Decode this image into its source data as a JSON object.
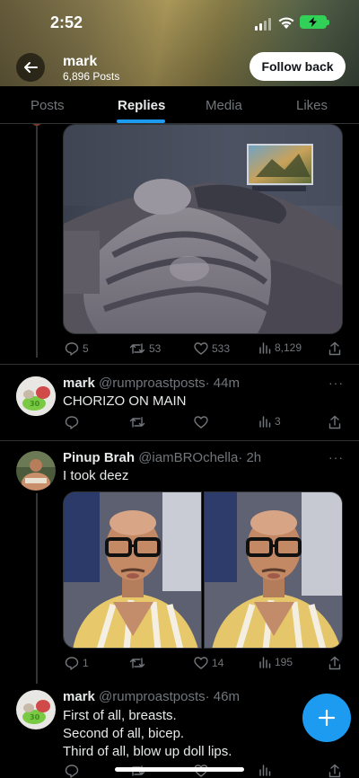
{
  "status_bar": {
    "time": "2:52"
  },
  "profile": {
    "name": "mark",
    "posts_count": "6,896 Posts",
    "follow_label": "Follow back"
  },
  "tabs": [
    {
      "label": "Posts"
    },
    {
      "label": "Replies"
    },
    {
      "label": "Media"
    },
    {
      "label": "Likes"
    }
  ],
  "active_tab": "Replies",
  "posts": [
    {
      "media": "image",
      "stats": {
        "replies": "5",
        "reposts": "53",
        "likes": "533",
        "views": "8,129"
      }
    },
    {
      "name": "mark",
      "handle": "@rumproastposts",
      "time": "· 44m",
      "text": "CHORIZO ON MAIN",
      "stats": {
        "replies": "",
        "reposts": "",
        "likes": "",
        "views": "3"
      }
    },
    {
      "name": "Pinup Brah",
      "handle": "@iamBROchella",
      "time": "· 2h",
      "text": "I took deez",
      "stats": {
        "replies": "1",
        "reposts": "",
        "likes": "14",
        "views": "195"
      }
    },
    {
      "name": "mark",
      "handle": "@rumproastposts",
      "time": "· 46m",
      "lines": [
        "First of all, breasts.",
        "Second of all, bicep.",
        "Third of all, blow up doll lips."
      ]
    }
  ],
  "more_label": "···",
  "icons": [
    "back-arrow-icon",
    "reply-icon",
    "repost-icon",
    "like-icon",
    "views-icon",
    "share-icon",
    "compose-plus-icon",
    "signal-icon",
    "wifi-icon",
    "battery-charging-icon"
  ],
  "colors": {
    "accent": "#1d9bf0",
    "background": "#000000",
    "muted": "#71767b",
    "battery": "#31d158"
  }
}
